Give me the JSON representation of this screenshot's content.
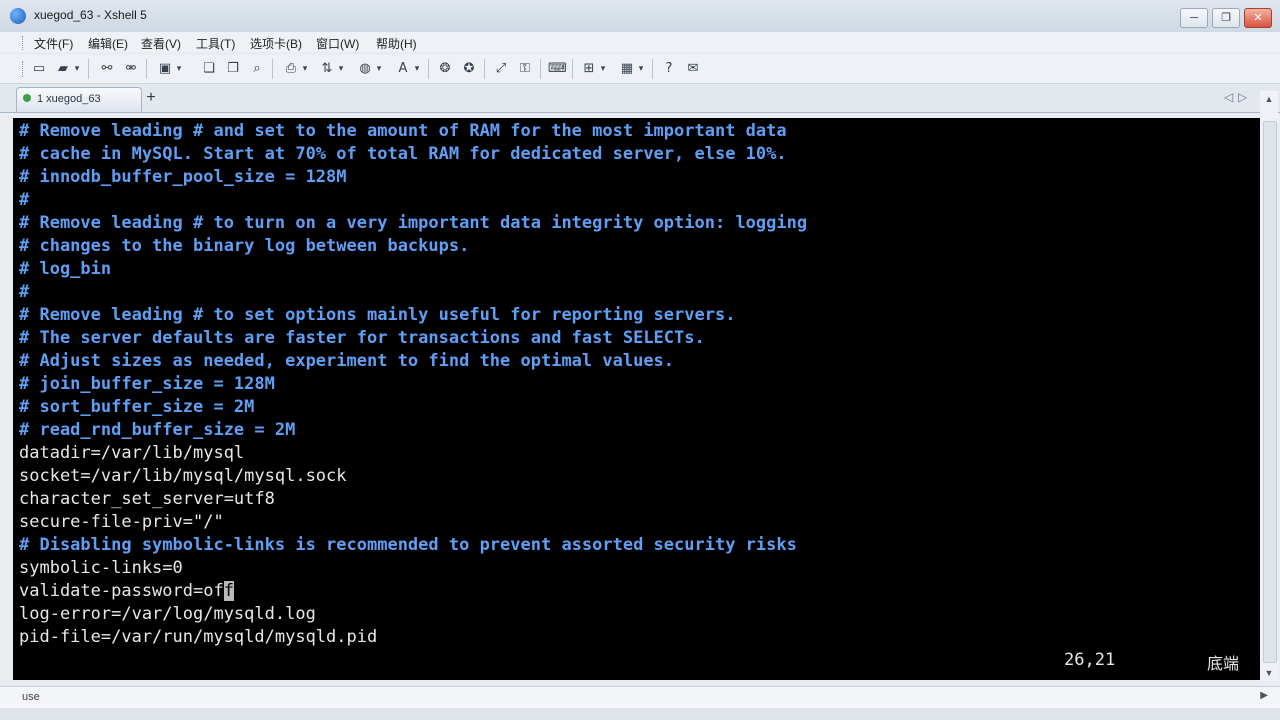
{
  "window": {
    "title": "xuegod_63 - Xshell 5",
    "buttons": {
      "minimize": "─",
      "restore": "❐",
      "close": "✕"
    }
  },
  "menu": [
    {
      "label": "文件(F)"
    },
    {
      "label": "编辑(E)"
    },
    {
      "label": "查看(V)"
    },
    {
      "label": "工具(T)"
    },
    {
      "label": "选项卡(B)"
    },
    {
      "label": "窗口(W)"
    },
    {
      "label": "帮助(H)"
    }
  ],
  "tabs": [
    {
      "label": "1 xuegod_63"
    }
  ],
  "tab_add": "+",
  "tab_nav": {
    "prev": "◁",
    "next": "▷",
    "menu": "▾"
  },
  "terminal": {
    "lines": [
      {
        "text": "# Remove leading # and set to the amount of RAM for the most important data",
        "type": "comment"
      },
      {
        "text": "# cache in MySQL. Start at 70% of total RAM for dedicated server, else 10%.",
        "type": "comment"
      },
      {
        "text": "# innodb_buffer_pool_size = 128M",
        "type": "comment"
      },
      {
        "text": "#",
        "type": "comment"
      },
      {
        "text": "# Remove leading # to turn on a very important data integrity option: logging",
        "type": "comment"
      },
      {
        "text": "# changes to the binary log between backups.",
        "type": "comment"
      },
      {
        "text": "# log_bin",
        "type": "comment"
      },
      {
        "text": "#",
        "type": "comment"
      },
      {
        "text": "# Remove leading # to set options mainly useful for reporting servers.",
        "type": "comment"
      },
      {
        "text": "# The server defaults are faster for transactions and fast SELECTs.",
        "type": "comment"
      },
      {
        "text": "# Adjust sizes as needed, experiment to find the optimal values.",
        "type": "comment"
      },
      {
        "text": "# join_buffer_size = 128M",
        "type": "comment"
      },
      {
        "text": "# sort_buffer_size = 2M",
        "type": "comment"
      },
      {
        "text": "# read_rnd_buffer_size = 2M",
        "type": "comment"
      },
      {
        "text": "datadir=/var/lib/mysql",
        "type": "normal"
      },
      {
        "text": "socket=/var/lib/mysql/mysql.sock",
        "type": "normal"
      },
      {
        "text": "character_set_server=utf8",
        "type": "normal"
      },
      {
        "text": "secure-file-priv=\"/\"",
        "type": "normal"
      },
      {
        "text": "# Disabling symbolic-links is recommended to prevent assorted security risks",
        "type": "comment"
      },
      {
        "text": "symbolic-links=0",
        "type": "normal"
      },
      {
        "text": "validate-password=off",
        "type": "cursor",
        "before": "validate-password=of",
        "cursor_char": "f"
      },
      {
        "text": "log-error=/var/log/mysqld.log",
        "type": "normal"
      },
      {
        "text": "pid-file=/var/run/mysqld/mysqld.pid",
        "type": "normal"
      }
    ],
    "status_position": "26,21",
    "status_scroll": "底端"
  },
  "compose_bar": {
    "text": "use"
  },
  "colors": {
    "terminal_bg": "#000000",
    "comment_fg": "#5f9ff5",
    "text_fg": "#e8e8e8",
    "cursor_bg": "#b9b9b9"
  }
}
